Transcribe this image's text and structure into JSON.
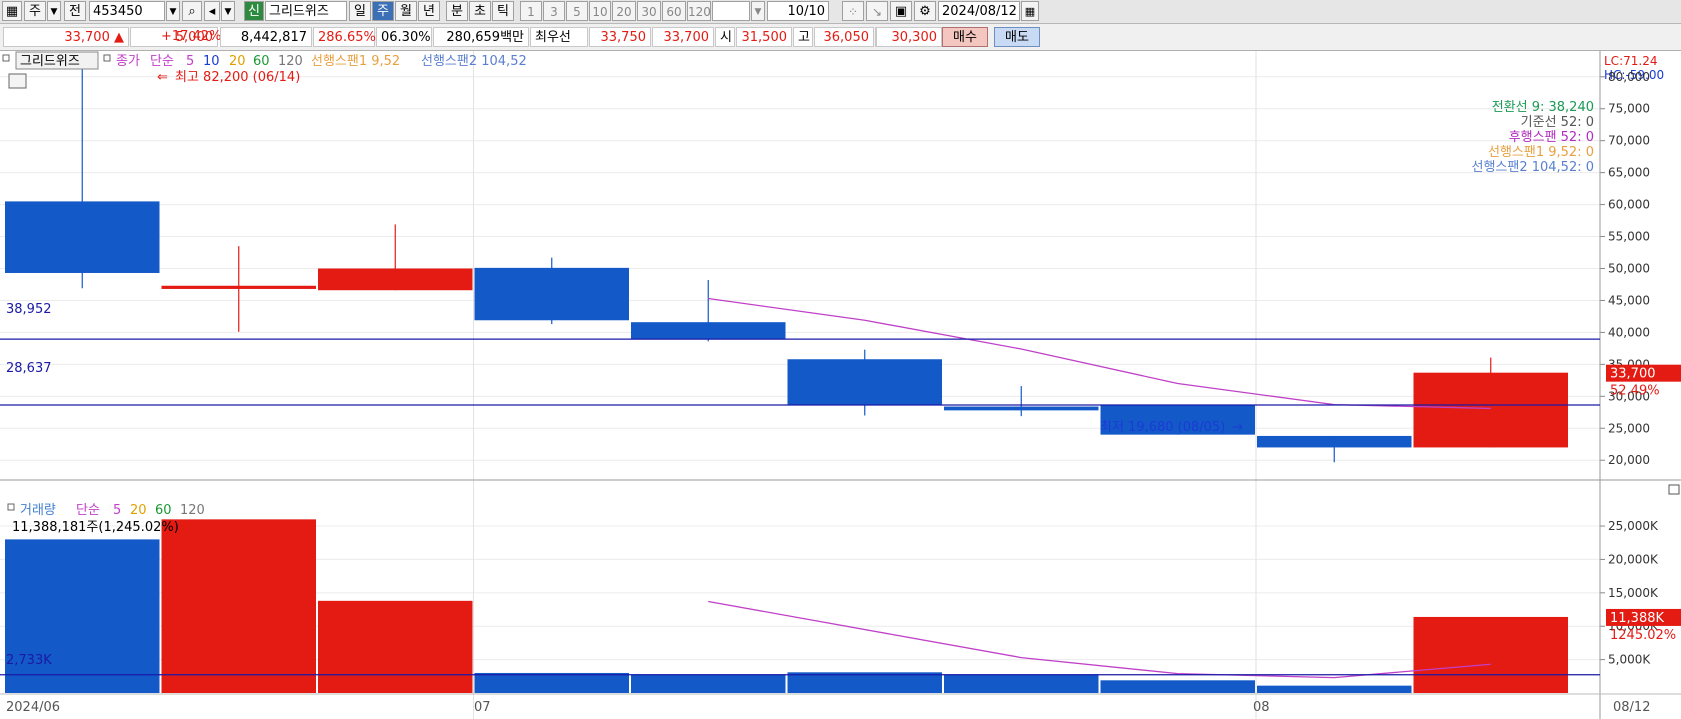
{
  "toolbar": {
    "period_type": "주",
    "prefix": "전",
    "code": "453450",
    "badge": "신",
    "name": "그리드위즈",
    "periods": [
      "일",
      "주",
      "월",
      "년",
      "분",
      "초",
      "틱"
    ],
    "active_period": "주",
    "intervals": [
      "1",
      "3",
      "5",
      "10",
      "20",
      "30",
      "60",
      "120"
    ],
    "count": "10/10",
    "date": "2024/08/12"
  },
  "infobar": {
    "price": "33,700",
    "change": "5,000",
    "change_pct": "+17.42%",
    "volume": "8,442,817",
    "vol_ratio": "286.65%",
    "turnover": "06.30%",
    "amount": "280,659백만",
    "best_label": "최우선",
    "ask": "33,750",
    "bid": "33,700",
    "open_label": "시",
    "open": "31,500",
    "high_label": "고",
    "high": "36,050",
    "low_label": "저",
    "low": "30,300",
    "buy_label": "매수",
    "sell_label": "매도"
  },
  "price_panel": {
    "tool_label": "그리드위즈",
    "legend_close": "종가",
    "legend_simple": "단순",
    "ma": [
      "5",
      "10",
      "20",
      "60",
      "120"
    ],
    "span1": "선행스팬1 9,52",
    "span2": "선행스팬2 104,52",
    "max_note": "최고 82,200 (06/14)",
    "min_note": "최저 19,680 (08/05)",
    "lc": "LC:71.24",
    "hc": "HC:-59.00",
    "h_line1": "38,952",
    "h_line2": "28,637",
    "ichimoku": [
      {
        "text": "전환선 9: 38,240",
        "color": "#1a9a55"
      },
      {
        "text": "기준선 52: 0",
        "color": "#555555"
      },
      {
        "text": "후행스팬 52: 0",
        "color": "#b02cc0"
      },
      {
        "text": "선행스팬1 9,52: 0",
        "color": "#e8a040"
      },
      {
        "text": "선행스팬2 104,52: 0",
        "color": "#5a7fd0"
      }
    ],
    "y_labels": [
      "80,000",
      "75,000",
      "70,000",
      "65,000",
      "60,000",
      "55,000",
      "50,000",
      "45,000",
      "40,000",
      "35,000",
      "30,000",
      "25,000",
      "20,000"
    ],
    "last_price": "33,700",
    "last_pct": "52.49%"
  },
  "volume_panel": {
    "title": "거래량",
    "legend_simple": "단순",
    "ma": [
      "5",
      "20",
      "60",
      "120"
    ],
    "current": "11,388,181주(1,245.02%)",
    "h_line": "2,733K",
    "y_labels": [
      "25,000K",
      "20,000K",
      "15,000K",
      "10,000K",
      "5,000K"
    ],
    "last_vol": "11,388K",
    "last_pct": "1245.02%"
  },
  "x_labels": [
    "2024/06",
    "07",
    "08",
    "08/12"
  ],
  "colors": {
    "up": "#e41b13",
    "down": "#1459c8",
    "ma": "#c040c8",
    "hline": "#1a1aa8"
  },
  "chart_data": [
    {
      "type": "candlestick",
      "title": "",
      "candles": [
        {
          "open": 60500,
          "high": 82200,
          "low": 46900,
          "close": 49300,
          "volume": 23000000
        },
        {
          "open": 46800,
          "high": 53500,
          "low": 40100,
          "close": 47300,
          "volume": 26000000
        },
        {
          "open": 46600,
          "high": 56900,
          "low": 46600,
          "close": 50000,
          "volume": 13800000
        },
        {
          "open": 50100,
          "high": 51700,
          "low": 41300,
          "close": 41900,
          "volume": 3000000
        },
        {
          "open": 41600,
          "high": 48200,
          "low": 38600,
          "close": 39000,
          "volume": 2800000
        },
        {
          "open": 35800,
          "high": 37300,
          "low": 27000,
          "close": 28600,
          "volume": 3100000
        },
        {
          "open": 28400,
          "high": 31600,
          "low": 26900,
          "close": 27800,
          "volume": 2800000
        },
        {
          "open": 28600,
          "high": 28600,
          "low": 24000,
          "close": 24000,
          "volume": 1900000
        },
        {
          "open": 23800,
          "high": 23800,
          "low": 19680,
          "close": 22000,
          "volume": 1100000
        },
        {
          "open": 22000,
          "high": 36050,
          "low": 22000,
          "close": 33700,
          "volume": 11388181
        }
      ],
      "ma5": [
        null,
        null,
        null,
        null,
        45300,
        null,
        null,
        null,
        31200,
        null
      ],
      "ma5_points": [
        [
          4,
          45300
        ],
        [
          5,
          41900
        ],
        [
          6,
          37400
        ],
        [
          7,
          32000
        ],
        [
          8,
          28700
        ],
        [
          9,
          28100
        ]
      ],
      "ylim": [
        18000,
        82000
      ]
    },
    {
      "type": "bar",
      "title": "거래량",
      "values": [
        23000000,
        26000000,
        13800000,
        3000000,
        2800000,
        3100000,
        2800000,
        1900000,
        1100000,
        11388181
      ],
      "ma5_points": [
        [
          4,
          13700000
        ],
        [
          6,
          5300000
        ],
        [
          7,
          2900000
        ],
        [
          8,
          2300000
        ],
        [
          9,
          4300000
        ]
      ],
      "ylim": [
        0,
        28000000
      ]
    }
  ]
}
